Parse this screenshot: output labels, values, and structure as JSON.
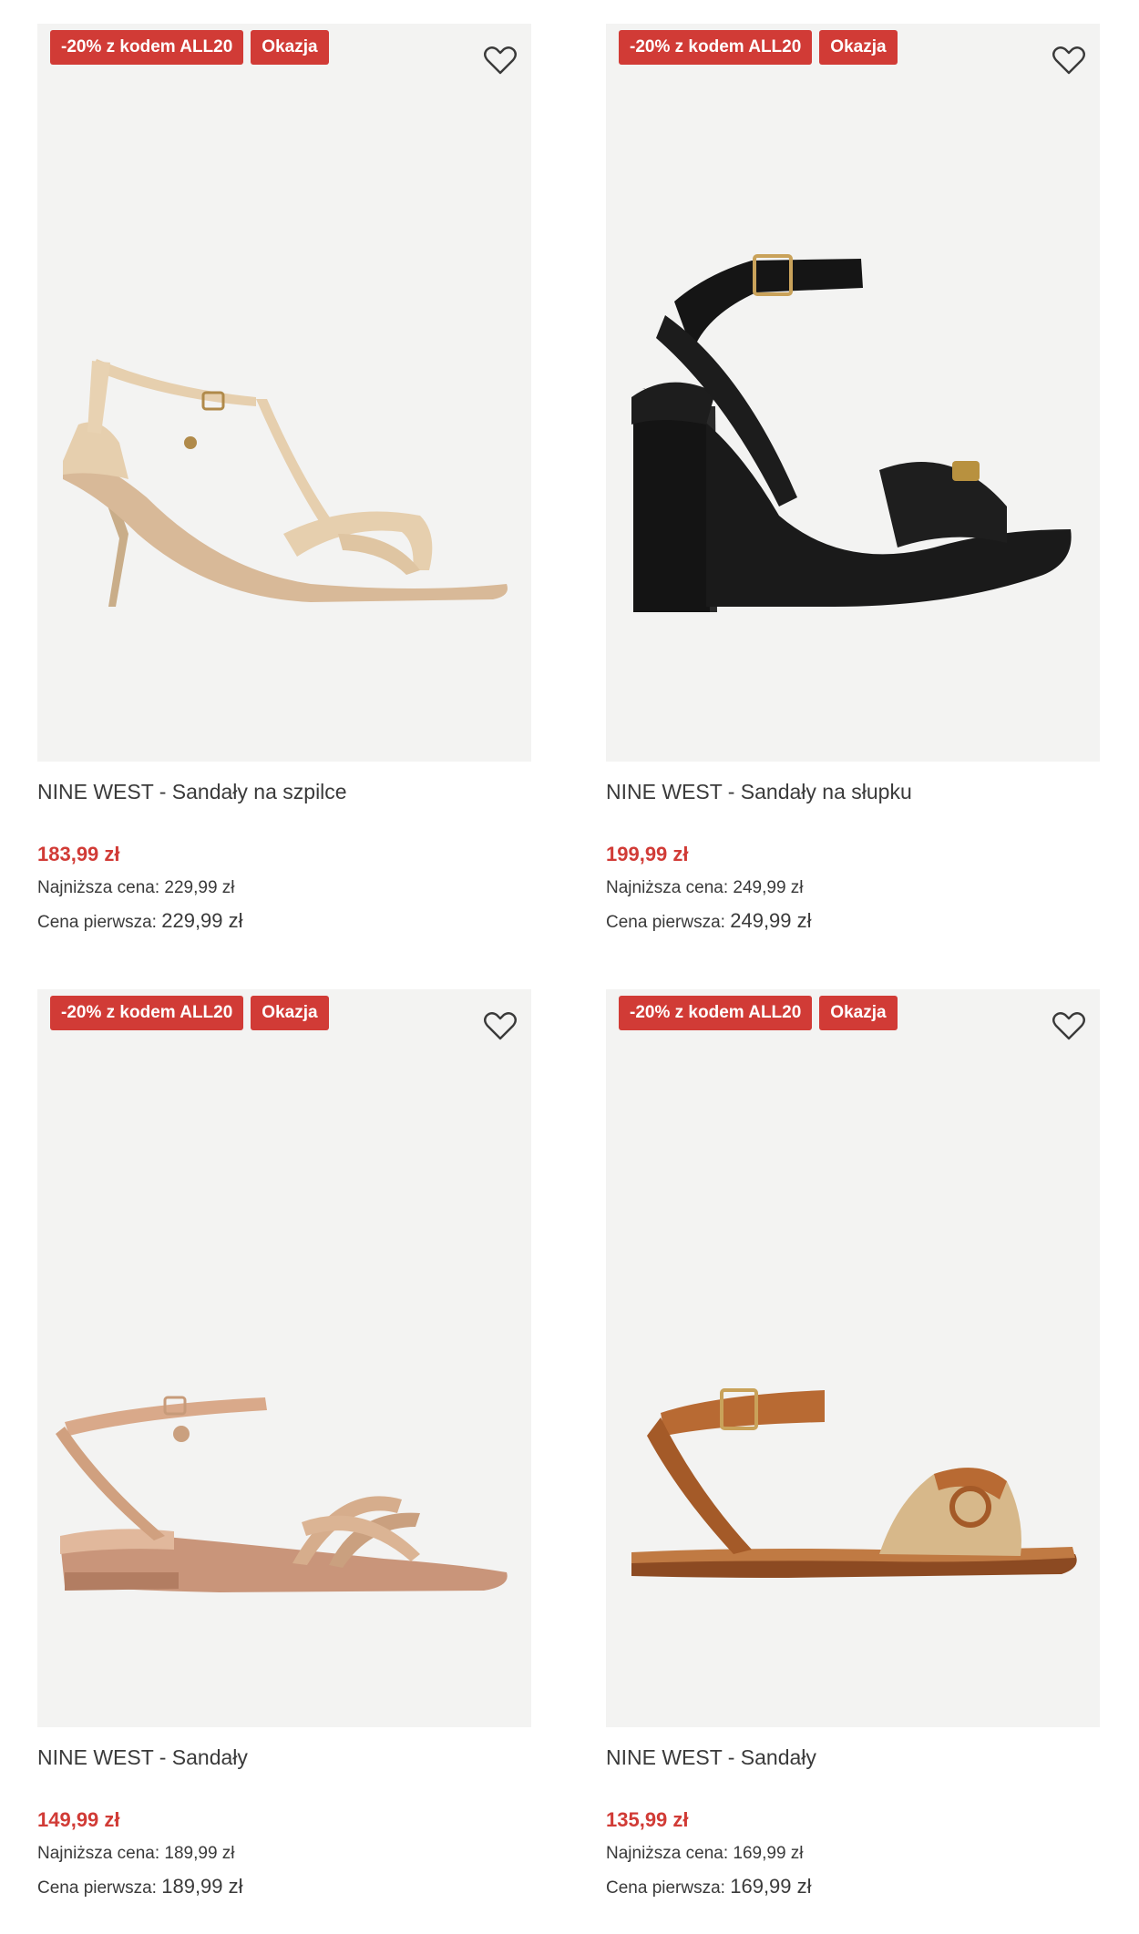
{
  "products": [
    {
      "badge_code": "-20% z kodem ALL20",
      "badge_deal": "Okazja",
      "name": "NINE WEST - Sandały na szpilce",
      "price": "183,99 zł",
      "lowest_label": "Najniższa cena:",
      "lowest_value": "229,99 zł",
      "first_label": "Cena pierwsza:",
      "first_value": "229,99 zł",
      "color": "#e6cfae",
      "fav_icon": "heart-outline-icon"
    },
    {
      "badge_code": "-20% z kodem ALL20",
      "badge_deal": "Okazja",
      "name": "NINE WEST - Sandały na słupku",
      "price": "199,99 zł",
      "lowest_label": "Najniższa cena:",
      "lowest_value": "249,99 zł",
      "first_label": "Cena pierwsza:",
      "first_value": "249,99 zł",
      "color": "#151515",
      "fav_icon": "heart-outline-icon"
    },
    {
      "badge_code": "-20% z kodem ALL20",
      "badge_deal": "Okazja",
      "name": "NINE WEST - Sandały",
      "price": "149,99 zł",
      "lowest_label": "Najniższa cena:",
      "lowest_value": "189,99 zł",
      "first_label": "Cena pierwsza:",
      "first_value": "189,99 zł",
      "color": "#d9a98a",
      "fav_icon": "heart-outline-icon"
    },
    {
      "badge_code": "-20% z kodem ALL20",
      "badge_deal": "Okazja",
      "name": "NINE WEST - Sandały",
      "price": "135,99 zł",
      "lowest_label": "Najniższa cena:",
      "lowest_value": "169,99 zł",
      "first_label": "Cena pierwsza:",
      "first_value": "169,99 zł",
      "color": "#b86a33",
      "fav_icon": "heart-outline-icon"
    }
  ],
  "colors": {
    "accent": "#d13b36",
    "image_bg": "#f3f3f2"
  }
}
